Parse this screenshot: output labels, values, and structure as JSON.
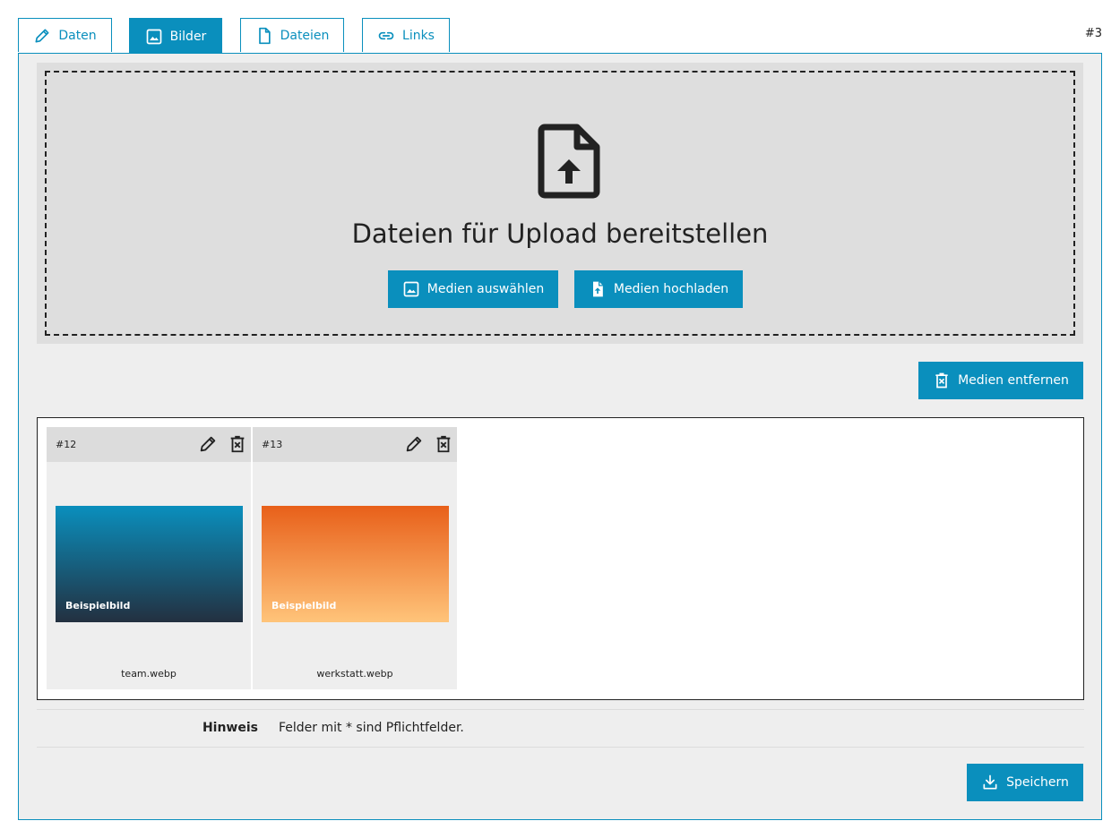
{
  "tabs": [
    {
      "label": "Daten",
      "icon": "pencil-icon"
    },
    {
      "label": "Bilder",
      "icon": "image-icon",
      "active": true
    },
    {
      "label": "Dateien",
      "icon": "file-icon"
    },
    {
      "label": "Links",
      "icon": "link-icon"
    }
  ],
  "record_id": "#3",
  "dropzone": {
    "title": "Dateien für Upload bereitstellen",
    "select_label": "Medien auswählen",
    "upload_label": "Medien hochladen"
  },
  "remove_label": "Medien entfernen",
  "media": [
    {
      "id": "#12",
      "caption": "Beispielbild",
      "filename": "team.webp"
    },
    {
      "id": "#13",
      "caption": "Beispielbild",
      "filename": "werkstatt.webp"
    }
  ],
  "hint": {
    "label": "Hinweis",
    "text": "Felder mit * sind Pflichtfelder."
  },
  "save_label": "Speichern",
  "colors": {
    "accent": "#0a8fbd",
    "panel_bg": "#eeeeee",
    "dropzone_bg": "#dedede"
  }
}
